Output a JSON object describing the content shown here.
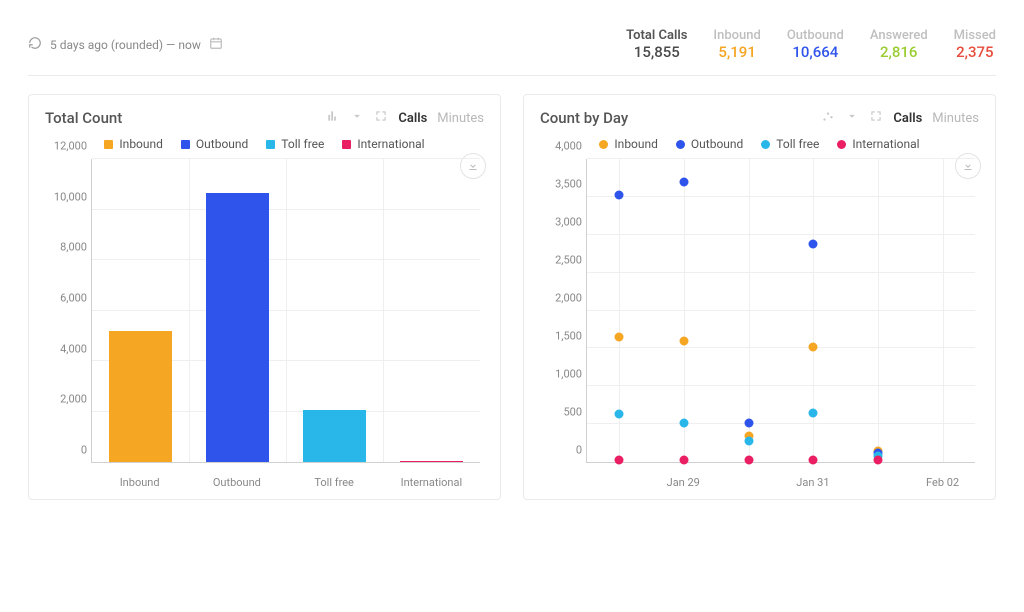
{
  "timerange": {
    "text": "5 days ago (rounded)  —  now"
  },
  "metrics": {
    "total": {
      "label": "Total Calls",
      "value": "15,855"
    },
    "inbound": {
      "label": "Inbound",
      "value": "5,191"
    },
    "outbound": {
      "label": "Outbound",
      "value": "10,664"
    },
    "answered": {
      "label": "Answered",
      "value": "2,816"
    },
    "missed": {
      "label": "Missed",
      "value": "2,375"
    }
  },
  "legend": {
    "inbound": "Inbound",
    "outbound": "Outbound",
    "tollfree": "Toll free",
    "international": "International"
  },
  "tabs": {
    "calls": "Calls",
    "minutes": "Minutes"
  },
  "panel_left": {
    "title": "Total Count",
    "yticks": [
      "0",
      "2,000",
      "4,000",
      "6,000",
      "8,000",
      "10,000",
      "12,000"
    ],
    "xticks": [
      "Inbound",
      "Outbound",
      "Toll free",
      "International"
    ]
  },
  "panel_right": {
    "title": "Count by Day",
    "yticks": [
      "0",
      "500",
      "1,000",
      "1,500",
      "2,000",
      "2,500",
      "3,000",
      "3,500",
      "4,000"
    ],
    "xticks": [
      "Jan 29",
      "Jan 31",
      "Feb 02"
    ]
  },
  "chart_data": [
    {
      "type": "bar",
      "title": "Total Count",
      "ylabel": "",
      "xlabel": "",
      "ylim": [
        0,
        12000
      ],
      "categories": [
        "Inbound",
        "Outbound",
        "Toll free",
        "International"
      ],
      "series": [
        {
          "name": "Inbound",
          "color": "#f5a623",
          "values": [
            5191,
            null,
            null,
            null
          ]
        },
        {
          "name": "Outbound",
          "color": "#2f54eb",
          "values": [
            null,
            10664,
            null,
            null
          ]
        },
        {
          "name": "Toll free",
          "color": "#29b6e8",
          "values": [
            null,
            null,
            2050,
            null
          ]
        },
        {
          "name": "International",
          "color": "#e91e63",
          "values": [
            null,
            null,
            null,
            60
          ]
        }
      ],
      "bar_values": {
        "Inbound": 5191,
        "Outbound": 10664,
        "Toll free": 2050,
        "International": 60
      }
    },
    {
      "type": "scatter",
      "title": "Count by Day",
      "ylabel": "",
      "xlabel": "",
      "ylim": [
        0,
        4000
      ],
      "x": [
        "Jan 28",
        "Jan 29",
        "Jan 30",
        "Jan 31",
        "Feb 01",
        "Feb 02"
      ],
      "series": [
        {
          "name": "Inbound",
          "color": "#f5a623",
          "values": [
            1650,
            1600,
            350,
            1520,
            150,
            null
          ]
        },
        {
          "name": "Outbound",
          "color": "#2f54eb",
          "values": [
            3520,
            3700,
            520,
            2880,
            120,
            null
          ]
        },
        {
          "name": "Toll free",
          "color": "#29b6e8",
          "values": [
            640,
            520,
            280,
            650,
            80,
            null
          ]
        },
        {
          "name": "International",
          "color": "#e91e63",
          "values": [
            30,
            30,
            30,
            30,
            30,
            null
          ]
        }
      ]
    }
  ]
}
